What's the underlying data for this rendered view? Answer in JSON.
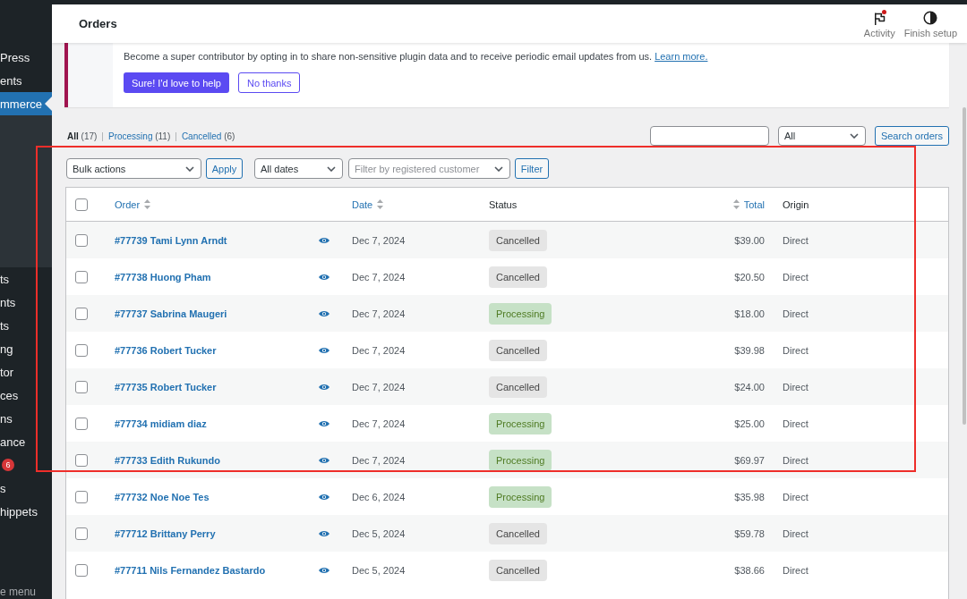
{
  "sidebar": {
    "items": [
      {
        "label": "Press",
        "selected": false,
        "expanded": false
      },
      {
        "label": "ents",
        "selected": false,
        "expanded": false
      },
      {
        "label": "mmerce",
        "selected": true,
        "expanded": true
      },
      {
        "label": "ts",
        "selected": false,
        "expanded": false
      },
      {
        "label": "nts",
        "selected": false,
        "expanded": false
      },
      {
        "label": "ts",
        "selected": false,
        "expanded": false
      },
      {
        "label": "ng",
        "selected": false,
        "expanded": false
      },
      {
        "label": "tor",
        "selected": false,
        "expanded": false
      },
      {
        "label": "ces",
        "selected": false,
        "expanded": false
      },
      {
        "label": "ns",
        "selected": false,
        "expanded": false
      },
      {
        "label": "ance",
        "selected": false,
        "expanded": false
      },
      {
        "badge": "6",
        "selected": false,
        "expanded": false
      },
      {
        "label": "s",
        "selected": false,
        "expanded": false
      },
      {
        "label": "hippets",
        "selected": false,
        "expanded": false
      }
    ],
    "collapse_label": "e menu"
  },
  "header": {
    "title": "Orders",
    "actions": [
      {
        "label": "Activity",
        "kind": "activity",
        "unread": true
      },
      {
        "label": "Finish setup",
        "kind": "setup",
        "unread": false
      }
    ]
  },
  "notice": {
    "text": "Become a super contributor by opting in to share non-sensitive plugin data and to receive periodic email updates from us.",
    "link": "Learn more.",
    "buttons": [
      {
        "label": "Sure! I'd love to help",
        "kind": "primary"
      },
      {
        "label": "No thanks",
        "kind": "secondary"
      }
    ]
  },
  "views": [
    {
      "label": "All",
      "count": "(17)",
      "selected": true
    },
    {
      "separator": "|",
      "label": "Processing",
      "count": "(11)",
      "selected": false
    },
    {
      "separator": "|",
      "label": "Cancelled",
      "count": "(6)",
      "selected": false
    }
  ],
  "search": {
    "status_select": "All",
    "button": "Search orders"
  },
  "toolbar": {
    "bulk_action": "Bulk actions",
    "apply": "Apply",
    "date_filter": "All dates",
    "customer_filter": {
      "placeholder": "Filter by registered customer"
    },
    "filter_button": "Filter"
  },
  "table": {
    "select_all": {
      "checked": false
    },
    "columns": [
      {
        "label": "Order",
        "kind": "order",
        "sortable": true
      },
      {
        "label": "Date",
        "kind": "date",
        "sortable": true
      },
      {
        "label": "Status",
        "kind": "status",
        "sortable": false
      },
      {
        "label": "Total",
        "kind": "total",
        "sortable": true
      },
      {
        "label": "Origin",
        "kind": "origin",
        "sortable": false
      }
    ],
    "rows": [
      {
        "order": "#77739 Tami Lynn Arndt",
        "date": "Dec 7, 2024",
        "status": "Cancelled",
        "color": "#e5e5e5",
        "total": "$39.00",
        "origin": "Direct",
        "checked": false
      },
      {
        "order": "#77738 Huong Pham",
        "date": "Dec 7, 2024",
        "status": "Cancelled",
        "color": "#e5e5e5",
        "total": "$20.50",
        "origin": "Direct",
        "checked": false
      },
      {
        "order": "#77737 Sabrina Maugeri",
        "date": "Dec 7, 2024",
        "status": "Processing",
        "color": "#c6e1c6",
        "total": "$18.00",
        "origin": "Direct",
        "checked": false
      },
      {
        "order": "#77736 Robert Tucker",
        "date": "Dec 7, 2024",
        "status": "Cancelled",
        "color": "#e5e5e5",
        "total": "$39.98",
        "origin": "Direct",
        "checked": false
      },
      {
        "order": "#77735 Robert Tucker",
        "date": "Dec 7, 2024",
        "status": "Cancelled",
        "color": "#e5e5e5",
        "total": "$24.00",
        "origin": "Direct",
        "checked": false
      },
      {
        "order": "#77734 midiam diaz",
        "date": "Dec 7, 2024",
        "status": "Processing",
        "color": "#c6e1c6",
        "total": "$25.00",
        "origin": "Direct",
        "checked": false
      },
      {
        "order": "#77733 Edith Rukundo",
        "date": "Dec 7, 2024",
        "status": "Processing",
        "color": "#c6e1c6",
        "total": "$69.97",
        "origin": "Direct",
        "checked": false
      },
      {
        "order": "#77732 Noe Noe Tes",
        "date": "Dec 6, 2024",
        "status": "Processing",
        "color": "#c6e1c6",
        "total": "$35.98",
        "origin": "Direct",
        "checked": false
      },
      {
        "order": "#77712 Brittany Perry",
        "date": "Dec 5, 2024",
        "status": "Cancelled",
        "color": "#e5e5e5",
        "total": "$59.78",
        "origin": "Direct",
        "checked": false
      },
      {
        "order": "#77711 Nils Fernandez Bastardo",
        "date": "Dec 5, 2024",
        "status": "Cancelled",
        "color": "#e5e5e5",
        "total": "$38.66",
        "origin": "Direct",
        "checked": false
      }
    ]
  },
  "annotation": {
    "kind": "frame"
  }
}
